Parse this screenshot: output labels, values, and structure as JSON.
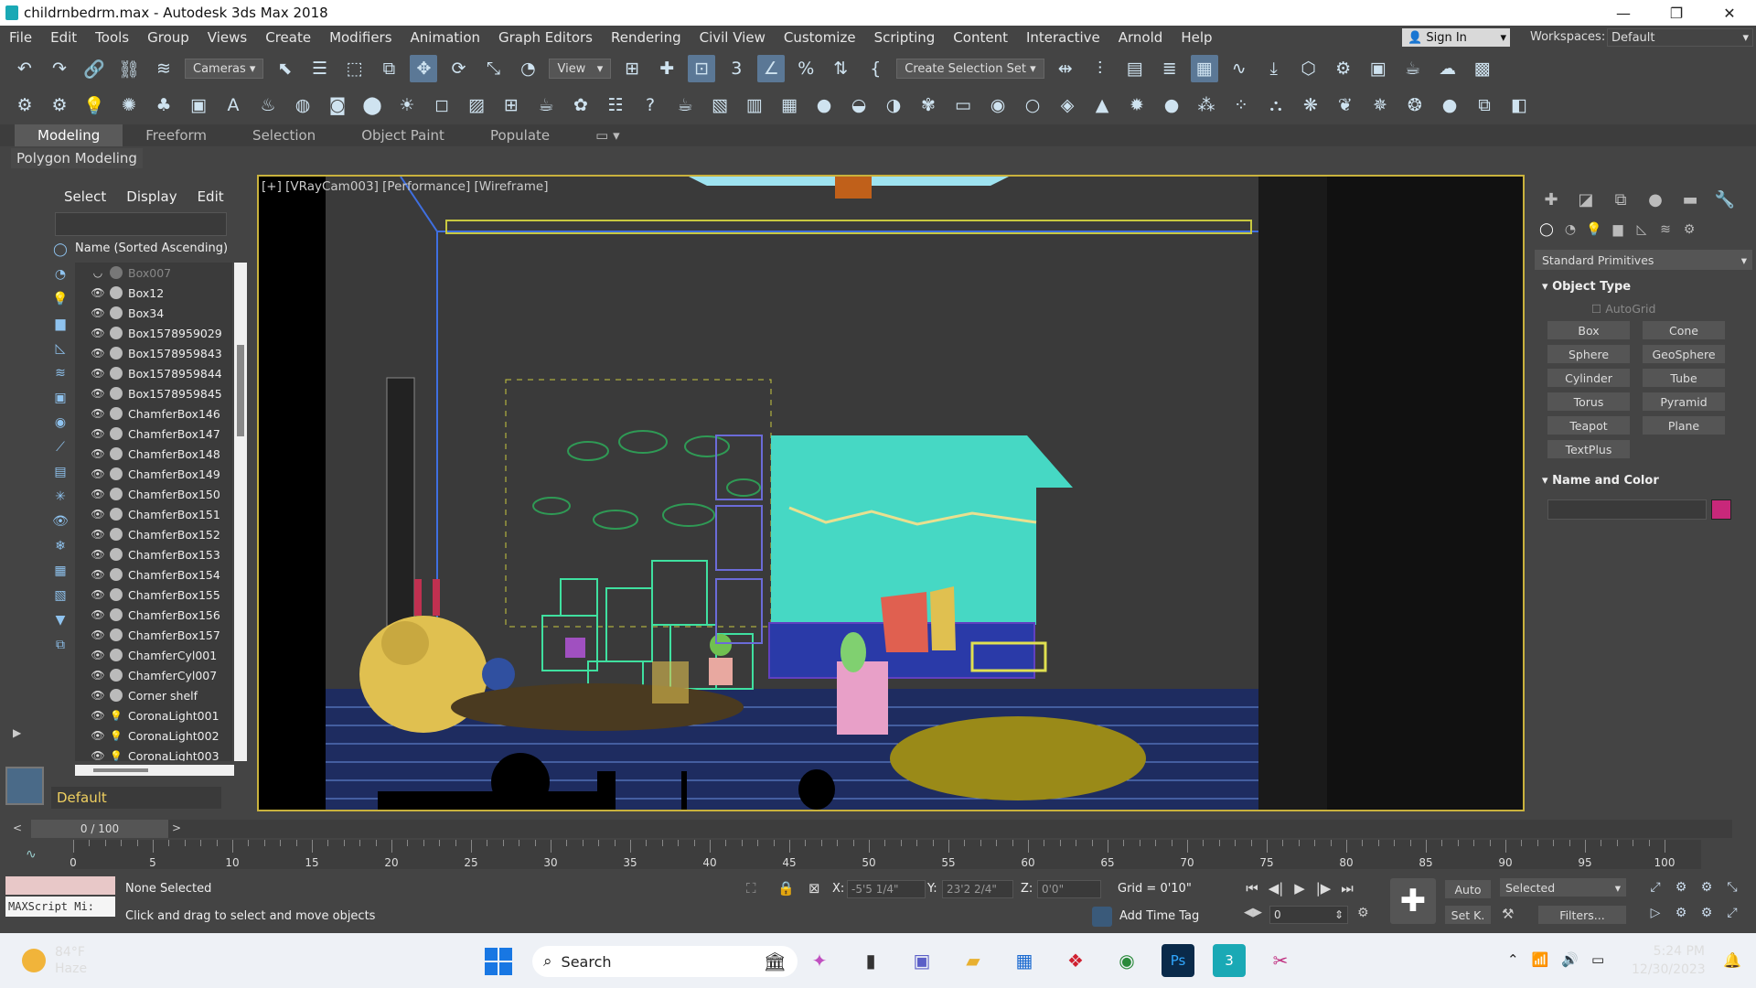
{
  "window": {
    "title": "childrnbedrm.max - Autodesk 3ds Max 2018",
    "min": "—",
    "max": "❐",
    "close": "✕"
  },
  "menu": [
    "File",
    "Edit",
    "Tools",
    "Group",
    "Views",
    "Create",
    "Modifiers",
    "Animation",
    "Graph Editors",
    "Rendering",
    "Civil View",
    "Customize",
    "Scripting",
    "Content",
    "Interactive",
    "Arnold",
    "Help"
  ],
  "signin": "Sign In",
  "workspaces": {
    "label": "Workspaces:",
    "value": "Default"
  },
  "toolbar1": {
    "cameras": "Cameras",
    "view": "View",
    "selection_set": "Create Selection Set"
  },
  "ribbon": {
    "tabs": [
      "Modeling",
      "Freeform",
      "Selection",
      "Object Paint",
      "Populate"
    ],
    "active": "Modeling",
    "sub": "Polygon Modeling"
  },
  "explorer": {
    "tabs": [
      "Select",
      "Display",
      "Edit"
    ],
    "header": "Name (Sorted Ascending)",
    "items": [
      "Box007",
      "Box12",
      "Box34",
      "Box1578959029",
      "Box1578959843",
      "Box1578959844",
      "Box1578959845",
      "ChamferBox146",
      "ChamferBox147",
      "ChamferBox148",
      "ChamferBox149",
      "ChamferBox150",
      "ChamferBox151",
      "ChamferBox152",
      "ChamferBox153",
      "ChamferBox154",
      "ChamferBox155",
      "ChamferBox156",
      "ChamferBox157",
      "ChamferCyl001",
      "ChamferCyl007",
      "Corner shelf",
      "CoronaLight001",
      "CoronaLight002",
      "CoronaLight003"
    ],
    "layer": "Default"
  },
  "viewport": {
    "label": "[+] [VRayCam003] [Performance] [Wireframe]"
  },
  "command_panel": {
    "category": "Standard Primitives",
    "object_type": "Object Type",
    "autogrid": "AutoGrid",
    "primitives": [
      "Box",
      "Cone",
      "Sphere",
      "GeoSphere",
      "Cylinder",
      "Tube",
      "Torus",
      "Pyramid",
      "Teapot",
      "Plane",
      "TextPlus"
    ],
    "name_color": "Name and Color",
    "swatch_color": "#c8287a"
  },
  "timeslider": {
    "value": "0 / 100"
  },
  "trackbar": {
    "labels": [
      "0",
      "5",
      "10",
      "15",
      "20",
      "25",
      "30",
      "35",
      "40",
      "45",
      "50",
      "55",
      "60",
      "65",
      "70",
      "75",
      "80",
      "85",
      "90",
      "95",
      "100"
    ]
  },
  "status": {
    "maxscript": "MAXScript Mi:",
    "selection": "None Selected",
    "prompt": "Click and drag to select and move objects",
    "x_label": "X:",
    "x_value": "-5'5 1/4\"",
    "y_label": "Y:",
    "y_value": "23'2 2/4\"",
    "z_label": "Z:",
    "z_value": "0'0\"",
    "grid": "Grid = 0'10\"",
    "add_time_tag": "Add Time Tag",
    "frame": "0",
    "auto": "Auto",
    "setk": "Set K.",
    "selected": "Selected",
    "filters": "Filters..."
  },
  "taskbar": {
    "temp": "84°F",
    "weather": "Haze",
    "search": "Search",
    "time": "5:24 PM",
    "date": "12/30/2023"
  }
}
